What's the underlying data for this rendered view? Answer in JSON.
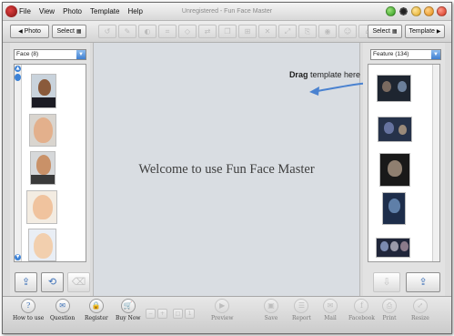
{
  "window": {
    "title": "Unregistered - Fun Face Master"
  },
  "menu": [
    "File",
    "View",
    "Photo",
    "Template",
    "Help"
  ],
  "toolbar": {
    "photo_button": "Photo",
    "select_left": "Select",
    "select_right": "Select",
    "template_button": "Template"
  },
  "left_panel": {
    "dropdown_value": "Face (8)",
    "thumbnails": [
      "face-photo-1",
      "face-photo-2",
      "face-photo-3",
      "face-photo-4",
      "face-photo-5"
    ]
  },
  "right_panel": {
    "dropdown_value": "Feature (134)",
    "thumbnails": [
      "feature-template-1",
      "feature-template-2",
      "feature-template-3",
      "feature-template-4",
      "feature-template-5"
    ]
  },
  "canvas": {
    "welcome_text": "Welcome to use Fun Face Master",
    "drag_bold": "Drag",
    "drag_rest": " template here"
  },
  "bottom_bar": {
    "how_to_use": "How to use",
    "question": "Question",
    "register": "Register",
    "buy_now": "Buy Now",
    "preview": "Preview",
    "save": "Save",
    "report": "Report",
    "mail": "Mail",
    "facebook": "Facebook",
    "print": "Print",
    "resize": "Resize"
  },
  "colors": {
    "accent": "#3d82d6",
    "canvas_bg": "#d9dde2",
    "panel_bg": "#e2e2e2"
  }
}
